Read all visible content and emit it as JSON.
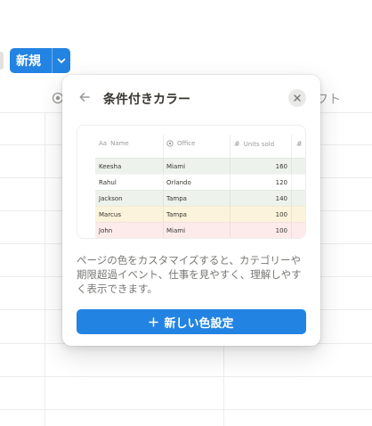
{
  "toolbar": {
    "new_button_label": "新規"
  },
  "header": {
    "partial_property_label": "フト"
  },
  "popup": {
    "title": "条件付きカラー",
    "description": "ページの色をカスタマイズすると、カテゴリーや期限超過イベント、仕事を見やすく、理解しやすく表示できます。",
    "add_button_label": "新しい色設定",
    "add_button_icon": "plus-icon",
    "preview": {
      "columns": [
        {
          "icon": "Aa",
          "label": "Name"
        },
        {
          "icon": "status-icon",
          "label": "Office"
        },
        {
          "icon": "#",
          "label": "Units sold"
        },
        {
          "icon": "#",
          "label": ""
        }
      ],
      "rows": [
        {
          "name": "Keesha",
          "office": "Miami",
          "units": "160",
          "color": "#edf3ec"
        },
        {
          "name": "Rahul",
          "office": "Orlando",
          "units": "120",
          "color": "#ffffff"
        },
        {
          "name": "Jackson",
          "office": "Tampa",
          "units": "140",
          "color": "#edf3ec"
        },
        {
          "name": "Marcus",
          "office": "Tampa",
          "units": "100",
          "color": "#fbf3db"
        },
        {
          "name": "John",
          "office": "Miami",
          "units": "100",
          "color": "#fdebec"
        },
        {
          "name": "",
          "office": "",
          "units": "",
          "color": "#fbf3db"
        }
      ]
    }
  },
  "colors": {
    "accent": "#2383e2",
    "green_row": "#edf3ec",
    "yellow_row": "#fbf3db",
    "red_row": "#fdebec"
  }
}
